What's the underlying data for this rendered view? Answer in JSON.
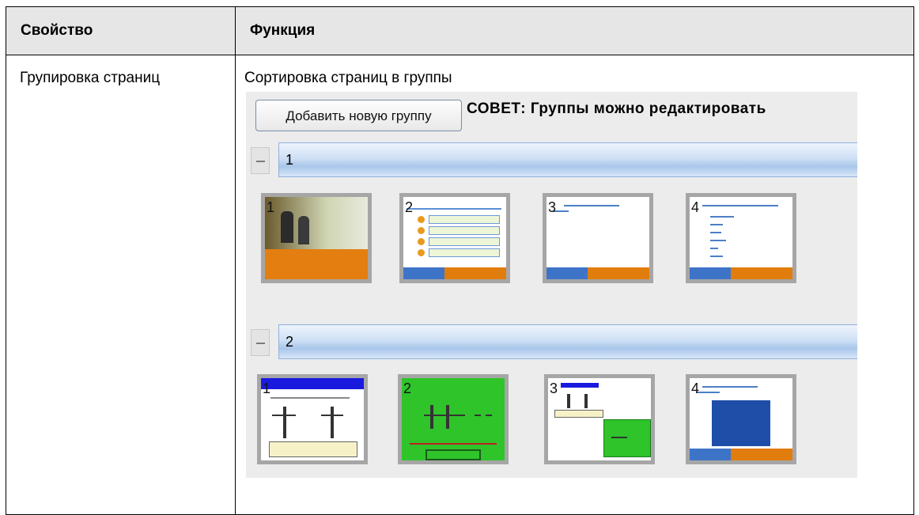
{
  "table": {
    "headers": [
      "Свойство",
      "Функция"
    ],
    "row": {
      "property": "Групировка страниц",
      "function": "Сортировка страниц в группы"
    }
  },
  "panel": {
    "add_group_label": "Добавить новую группу",
    "tip": "СОВЕТ: Группы можно редактировать",
    "groups": [
      {
        "label": "1",
        "thumbnails": [
          "1",
          "2",
          "3",
          "4"
        ]
      },
      {
        "label": "2",
        "thumbnails": [
          "1",
          "2",
          "3",
          "4"
        ]
      }
    ],
    "colors": {
      "group_bar": "#a9c6ea",
      "accent_orange": "#e17d0c",
      "accent_blue": "#3e74c7",
      "green_slide": "#2ec42a"
    }
  }
}
